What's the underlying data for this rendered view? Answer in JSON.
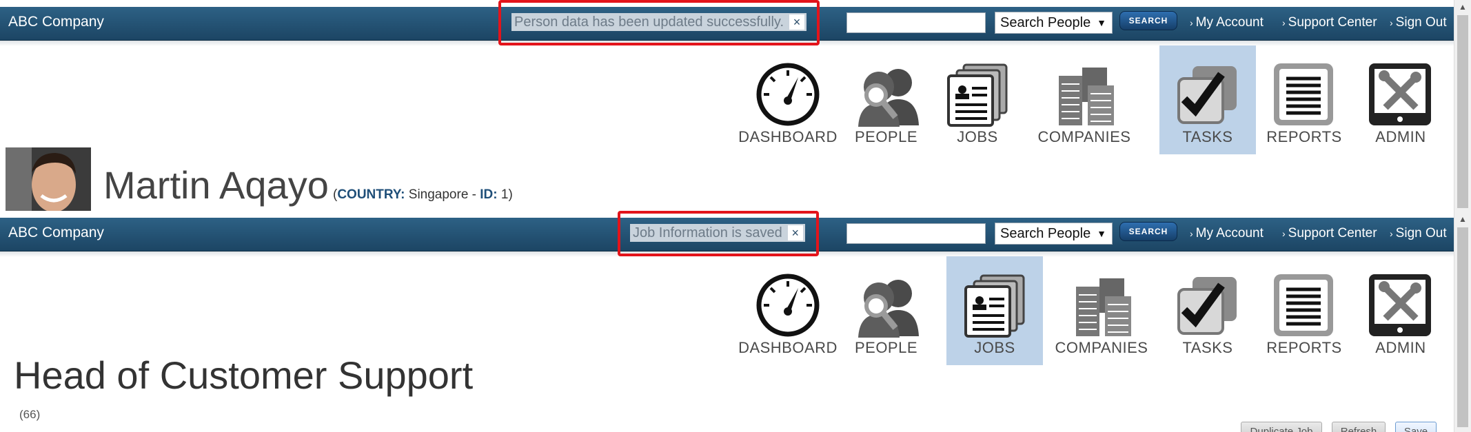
{
  "top": {
    "brand": "ABC Company",
    "message": "Person data has been updated successfully.",
    "close_glyph": "×",
    "search": {
      "value": "",
      "select_value": "Search People",
      "button": "SEARCH"
    },
    "links": [
      "My Account",
      "Support Center",
      "Sign Out"
    ],
    "nav": [
      {
        "label": "DASHBOARD",
        "icon": "dashboard-icon",
        "active": false
      },
      {
        "label": "PEOPLE",
        "icon": "people-icon",
        "active": false
      },
      {
        "label": "JOBS",
        "icon": "jobs-icon",
        "active": false
      },
      {
        "label": "COMPANIES",
        "icon": "companies-icon",
        "active": false
      },
      {
        "label": "TASKS",
        "icon": "tasks-icon",
        "active": true
      },
      {
        "label": "REPORTS",
        "icon": "reports-icon",
        "active": false
      },
      {
        "label": "ADMIN",
        "icon": "admin-icon",
        "active": false
      }
    ],
    "person": {
      "name": "Martin Aqayo",
      "country_label": "COUNTRY:",
      "country": "Singapore",
      "id_label": "ID:",
      "id": "1"
    }
  },
  "bottom": {
    "brand": "ABC Company",
    "message": "Job Information is saved",
    "close_glyph": "×",
    "search": {
      "value": "",
      "select_value": "Search People",
      "button": "SEARCH"
    },
    "links": [
      "My Account",
      "Support Center",
      "Sign Out"
    ],
    "nav": [
      {
        "label": "DASHBOARD",
        "icon": "dashboard-icon",
        "active": false
      },
      {
        "label": "PEOPLE",
        "icon": "people-icon",
        "active": false
      },
      {
        "label": "JOBS",
        "icon": "jobs-icon",
        "active": true
      },
      {
        "label": "COMPANIES",
        "icon": "companies-icon",
        "active": false
      },
      {
        "label": "TASKS",
        "icon": "tasks-icon",
        "active": false
      },
      {
        "label": "REPORTS",
        "icon": "reports-icon",
        "active": false
      },
      {
        "label": "ADMIN",
        "icon": "admin-icon",
        "active": false
      }
    ],
    "job": {
      "title": "Head of Customer Support",
      "sub": "(66)",
      "buttons": [
        "Duplicate Job",
        "Refresh",
        "Save"
      ]
    }
  },
  "colors": {
    "bar": "#1f4a6b",
    "active_nav": "#bdd2e8",
    "highlight": "#e3141b",
    "accent_text": "#1e4e78"
  }
}
